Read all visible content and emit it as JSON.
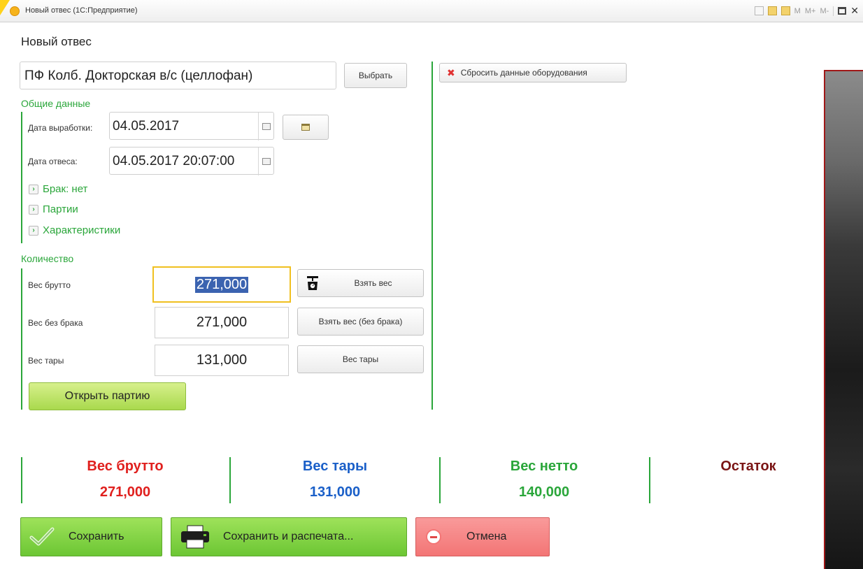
{
  "window": {
    "title": "Новый отвес  (1С:Предприятие)",
    "toolbar": {
      "m": "M",
      "mplus": "M+",
      "mminus": "M-",
      "close": "✕"
    }
  },
  "form": {
    "title": "Новый отвес",
    "product": {
      "value": "ПФ Колб. Докторская  в/с  (целлофан)",
      "select_label": "Выбрать"
    },
    "general_section": {
      "title": "Общие данные",
      "production_date": {
        "label": "Дата выработки:",
        "value": "04.05.2017"
      },
      "weighing_date": {
        "label": "Дата отвеса:",
        "value": "04.05.2017 20:07:00"
      }
    },
    "expanders": [
      "Брак: нет",
      "Партии",
      "Характеристики"
    ],
    "quantity_section": {
      "title": "Количество",
      "gross": {
        "label": "Вес брутто",
        "value": "271,000",
        "button": "Взять вес"
      },
      "no_defect": {
        "label": "Вес без брака",
        "value": "271,000",
        "button": "Взять вес (без брака)"
      },
      "tare": {
        "label": "Вес тары",
        "value": "131,000",
        "button": "Вес тары"
      },
      "open_batch": "Открыть партию"
    },
    "reset_equipment": "Сбросить данные оборудования"
  },
  "summary": {
    "gross": {
      "label": "Вес брутто",
      "value": "271,000",
      "color": "#e0201e"
    },
    "tare": {
      "label": "Вес  тары",
      "value": "131,000",
      "color": "#1a5fc8"
    },
    "net": {
      "label": "Вес нетто",
      "value": "140,000",
      "color": "#2aa63a"
    },
    "remainder": {
      "label": "Остаток",
      "value": "",
      "color": "#7a1414"
    }
  },
  "actions": {
    "save": "Сохранить",
    "save_print": "Сохранить и распечата...",
    "cancel": "Отмена"
  }
}
